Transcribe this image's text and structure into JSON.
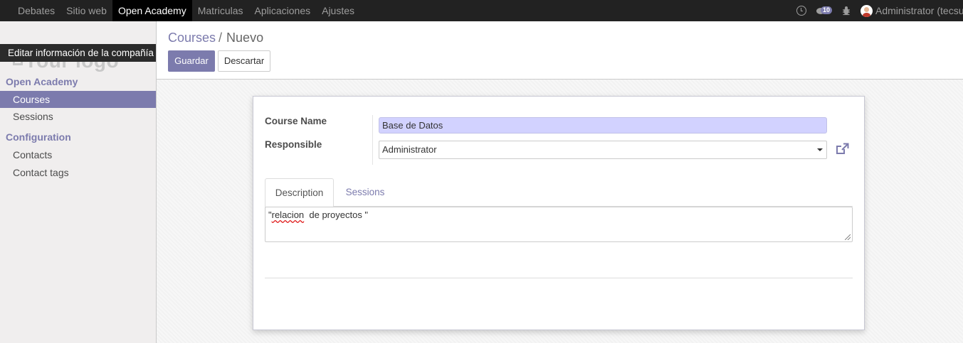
{
  "topbar": {
    "menu": [
      "Debates",
      "Sitio web",
      "Open Academy",
      "Matriculas",
      "Aplicaciones",
      "Ajustes"
    ],
    "active_index": 2,
    "messages_count": "10",
    "user": "Administrator (tecsup"
  },
  "sidebar": {
    "logo_text": "Your logo",
    "logo_tooltip": "Editar información de la compañía",
    "sections": [
      {
        "title": "Open Academy",
        "items": [
          "Courses",
          "Sessions"
        ]
      },
      {
        "title": "Configuration",
        "items": [
          "Contacts",
          "Contact tags"
        ]
      }
    ],
    "active_item": "Courses"
  },
  "control": {
    "breadcrumb_parent": "Courses",
    "breadcrumb_separator": "/",
    "breadcrumb_current": "Nuevo",
    "save_label": "Guardar",
    "discard_label": "Descartar"
  },
  "form": {
    "course_name_label": "Course Name",
    "course_name_value": "Base de Datos",
    "responsible_label": "Responsible",
    "responsible_value": "Administrator",
    "tabs": [
      "Description",
      "Sessions"
    ],
    "description_quote_open": "\"",
    "description_word_misspelled": "relacion",
    "description_rest": "  de proyectos \""
  },
  "colors": {
    "brand": "#7c7bad",
    "topbar_bg": "#222222",
    "required_field_bg": "#d2d2ff"
  }
}
